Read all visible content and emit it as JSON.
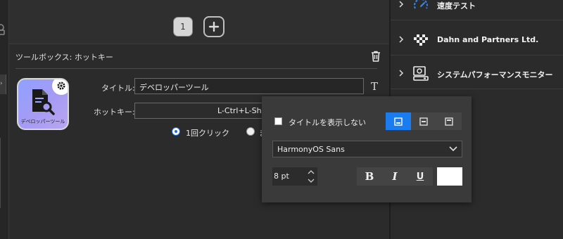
{
  "pager": {
    "current_page": "1"
  },
  "section": {
    "title": "ツールボックス: ホットキー"
  },
  "tool": {
    "icon_label": "デベロッパーツール"
  },
  "fields": {
    "title_label": "タイトル:",
    "title_value": "デベロッパーツール",
    "hotkey_label": "ホットキー:",
    "hotkey_value": "L-Ctrl+L-Sh"
  },
  "click_mode": {
    "option_1": "1回クリック",
    "option_2": "ま"
  },
  "tree": {
    "items": [
      {
        "label": "速度テスト",
        "icon": "speedometer-icon"
      },
      {
        "label": "Dahn and Partners Ltd.",
        "icon": "checker-logo-icon"
      },
      {
        "label": "システムパフォーマンスモニター",
        "icon": "monitor-icon"
      }
    ]
  },
  "popup": {
    "hide_title_label": "タイトルを表示しない",
    "hide_title_checked": false,
    "font": "HarmonyOS Sans",
    "size": "8 pt",
    "bold": "B",
    "italic": "I",
    "underline": "U",
    "text_color": "#ffffff",
    "selected_position": "bottom"
  },
  "colors": {
    "accent": "#1b7cf0",
    "panel": "#2b2b2b",
    "popup": "#3a3a3a"
  }
}
